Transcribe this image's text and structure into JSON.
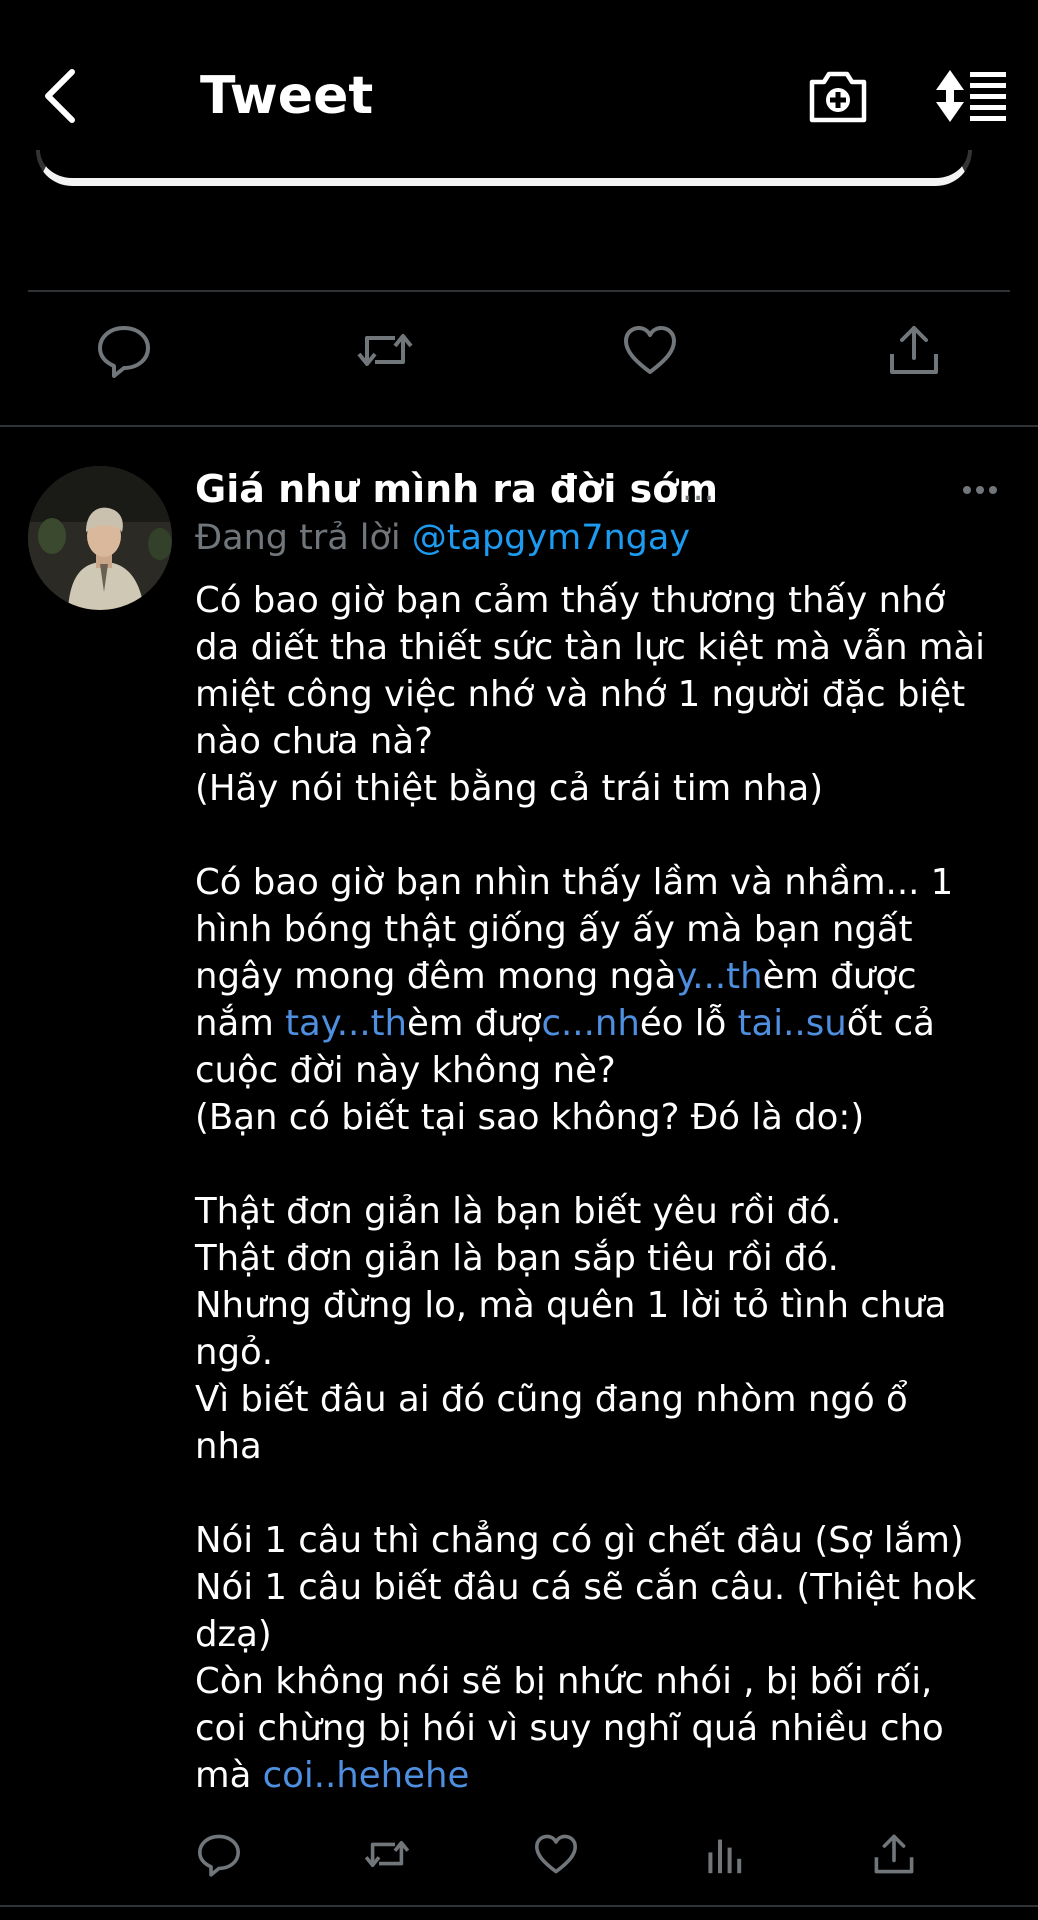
{
  "header": {
    "title": "Tweet",
    "icons": [
      "back-arrow-icon",
      "camera-plus-icon",
      "sort-list-icon"
    ]
  },
  "top_actions": {
    "icons": [
      "reply-icon",
      "retweet-icon",
      "like-icon",
      "share-icon"
    ]
  },
  "reply": {
    "author_name": "Giá như mình ra đời sớm",
    "author_dots": "...",
    "replying_prefix": "Đang trả lời",
    "replying_to": "@tapgym7ngay",
    "paragraph_1": [
      "Có bao giờ bạn cảm thấy thương thấy nhớ",
      "da diết tha thiết sức tàn lực kiệt mà vẫn mài",
      "miệt công việc nhớ và nhớ 1 người đặc biệt",
      "nào chưa nà?",
      "(Hãy nói thiệt bằng cả trái tim nha)"
    ],
    "paragraph_2": {
      "line_1": "Có bao giờ bạn nhìn thấy lầm và nhầm... 1",
      "line_2": "hình bóng thật giống ấy ấy mà bạn ngất",
      "line_3_a": "ngây mong đêm mong ngà",
      "line_3_b": "y...th",
      "line_3_c": "èm được",
      "line_4_a": "nắm ",
      "line_4_b": "tay...th",
      "line_4_c": "èm đượ",
      "line_4_d": "c...nh",
      "line_4_e": "éo lỗ ",
      "line_4_f": "tai..su",
      "line_4_g": "ốt cả",
      "line_5": "cuộc đời này không nè?",
      "line_6": "(Bạn có biết tại sao không? Đó là do:)"
    },
    "paragraph_3": [
      "Thật đơn giản là bạn biết yêu rồi đó.",
      "Thật đơn giản là bạn sắp tiêu rồi đó.",
      "Nhưng đừng lo, mà quên 1 lời tỏ tình chưa",
      "ngỏ.",
      "Vì biết đâu ai đó cũng đang nhòm ngó ổ",
      "nha"
    ],
    "paragraph_4": {
      "line_1": "Nói 1 câu thì chẳng có gì chết đâu (Sợ lắm)",
      "line_2": "Nói 1 câu biết đâu cá sẽ cắn câu. (Thiệt hok",
      "line_3": "dzạ)",
      "line_4": "Còn không nói sẽ bị nhức nhói , bị bối rối,",
      "line_5": "coi chừng bị hói vì suy nghĩ quá nhiều cho",
      "line_6_a": "mà ",
      "line_6_b": "coi..hehehe"
    },
    "bottom_action_icons": [
      "reply-icon",
      "retweet-icon",
      "like-icon",
      "analytics-icon",
      "share-icon"
    ]
  },
  "colors": {
    "background": "#000000",
    "text": "#ffffff",
    "muted": "#71767b",
    "link": "#1d9bf0",
    "highlight": "#4f8fe0",
    "divider": "#2f3336"
  }
}
